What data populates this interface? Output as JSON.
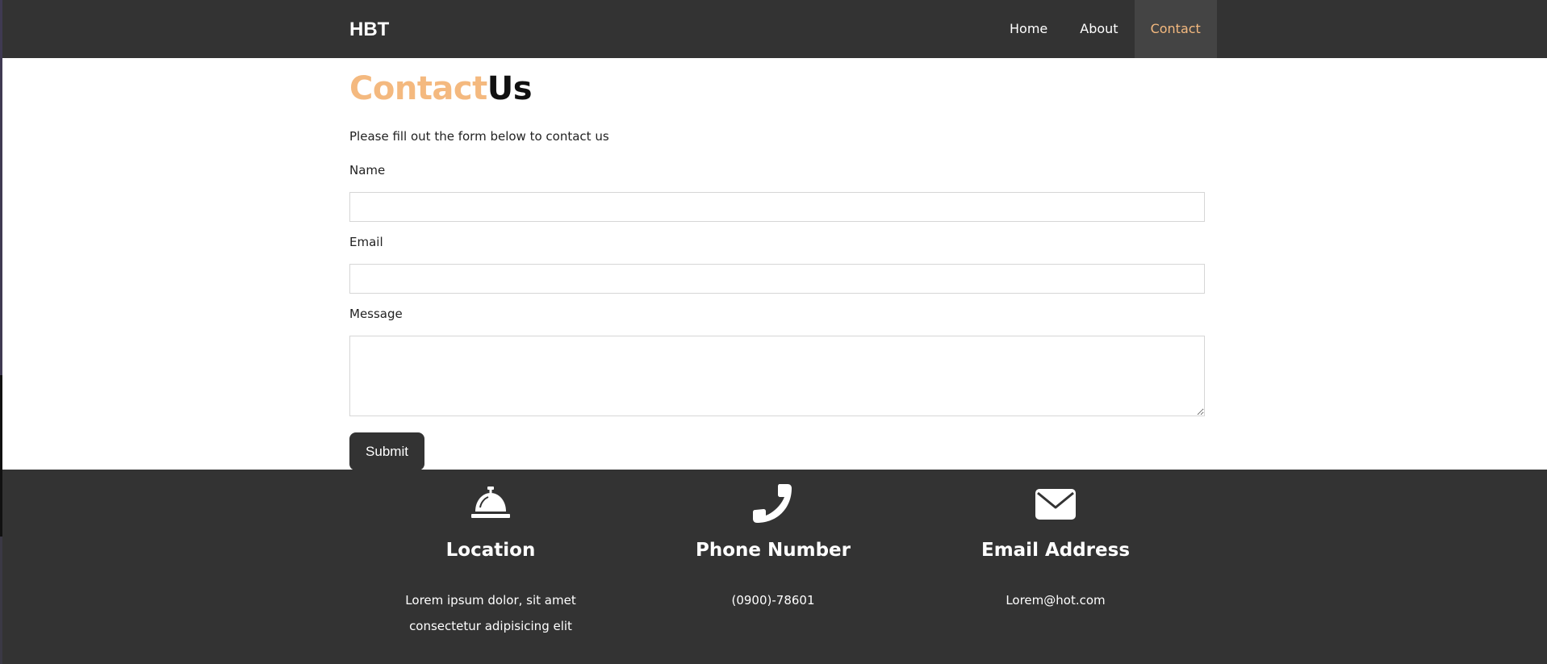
{
  "navbar": {
    "brand": "HBT",
    "links": [
      {
        "label": "Home",
        "active": false
      },
      {
        "label": "About",
        "active": false
      },
      {
        "label": "Contact",
        "active": true
      }
    ]
  },
  "main": {
    "heading_accent": "Contact",
    "heading_rest": "Us",
    "intro": "Please fill out the form below to contact us",
    "form": {
      "name_label": "Name",
      "name_value": "",
      "email_label": "Email",
      "email_value": "",
      "message_label": "Message",
      "message_value": "",
      "submit_label": "Submit"
    }
  },
  "footer": {
    "columns": [
      {
        "icon": "bell-icon",
        "title": "Location",
        "text": "Lorem ipsum dolor, sit amet consectetur adipisicing elit"
      },
      {
        "icon": "phone-icon",
        "title": "Phone Number",
        "text": "(0900)-78601"
      },
      {
        "icon": "envelope-icon",
        "title": "Email Address",
        "text": "Lorem@hot.com"
      }
    ]
  },
  "colors": {
    "dark": "#333333",
    "accent": "#f4b97f",
    "active_nav_bg": "#444444"
  }
}
